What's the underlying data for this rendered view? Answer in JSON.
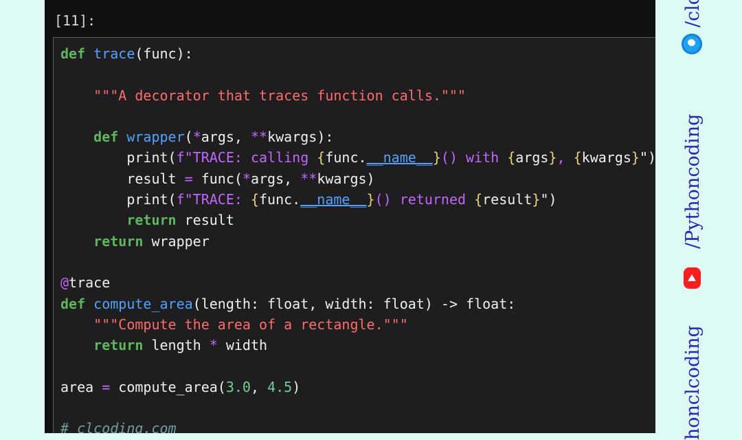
{
  "notebook": {
    "prompt": "[11]:",
    "code_lines": [
      [
        {
          "t": "def",
          "c": "kw"
        },
        {
          "t": " "
        },
        {
          "t": "trace",
          "c": "fn"
        },
        {
          "t": "(func):"
        }
      ],
      [
        {
          "t": ""
        }
      ],
      [
        {
          "t": "    "
        },
        {
          "t": "\"\"\"A decorator that traces function calls.\"\"\"",
          "c": "str"
        }
      ],
      [
        {
          "t": ""
        }
      ],
      [
        {
          "t": "    "
        },
        {
          "t": "def",
          "c": "kw"
        },
        {
          "t": " "
        },
        {
          "t": "wrapper",
          "c": "fn"
        },
        {
          "t": "("
        },
        {
          "t": "*",
          "c": "op"
        },
        {
          "t": "args, "
        },
        {
          "t": "**",
          "c": "op"
        },
        {
          "t": "kwargs):"
        }
      ],
      [
        {
          "t": "        print("
        },
        {
          "t": "f\"TRACE: calling ",
          "c": "fstr"
        },
        {
          "t": "{",
          "c": "brace"
        },
        {
          "t": "func."
        },
        {
          "t": "__name__",
          "c": "dunder"
        },
        {
          "t": "}",
          "c": "brace"
        },
        {
          "t": "() with ",
          "c": "fstr"
        },
        {
          "t": "{",
          "c": "brace"
        },
        {
          "t": "args"
        },
        {
          "t": "}",
          "c": "brace"
        },
        {
          "t": ", ",
          "c": "fstr"
        },
        {
          "t": "{",
          "c": "brace"
        },
        {
          "t": "kwargs"
        },
        {
          "t": "}",
          "c": "brace"
        },
        {
          "t": "\")"
        }
      ],
      [
        {
          "t": "        result "
        },
        {
          "t": "=",
          "c": "op"
        },
        {
          "t": " func("
        },
        {
          "t": "*",
          "c": "op"
        },
        {
          "t": "args, "
        },
        {
          "t": "**",
          "c": "op"
        },
        {
          "t": "kwargs)"
        }
      ],
      [
        {
          "t": "        print("
        },
        {
          "t": "f\"TRACE: ",
          "c": "fstr"
        },
        {
          "t": "{",
          "c": "brace"
        },
        {
          "t": "func."
        },
        {
          "t": "__name__",
          "c": "dunder"
        },
        {
          "t": "}",
          "c": "brace"
        },
        {
          "t": "() returned ",
          "c": "fstr"
        },
        {
          "t": "{",
          "c": "brace"
        },
        {
          "t": "result"
        },
        {
          "t": "}",
          "c": "brace"
        },
        {
          "t": "\")"
        }
      ],
      [
        {
          "t": "        "
        },
        {
          "t": "return",
          "c": "kw"
        },
        {
          "t": " result"
        }
      ],
      [
        {
          "t": "    "
        },
        {
          "t": "return",
          "c": "kw"
        },
        {
          "t": " wrapper"
        }
      ],
      [
        {
          "t": ""
        }
      ],
      [
        {
          "t": "@",
          "c": "op"
        },
        {
          "t": "trace"
        }
      ],
      [
        {
          "t": "def",
          "c": "kw"
        },
        {
          "t": " "
        },
        {
          "t": "compute_area",
          "c": "fn"
        },
        {
          "t": "(length: float, width: float) -> float:"
        }
      ],
      [
        {
          "t": "    "
        },
        {
          "t": "\"\"\"Compute the area of a rectangle.\"\"\"",
          "c": "str"
        }
      ],
      [
        {
          "t": "    "
        },
        {
          "t": "return",
          "c": "kw"
        },
        {
          "t": " length "
        },
        {
          "t": "*",
          "c": "op"
        },
        {
          "t": " width"
        }
      ],
      [
        {
          "t": ""
        }
      ],
      [
        {
          "t": "area "
        },
        {
          "t": "=",
          "c": "op"
        },
        {
          "t": " compute_area("
        },
        {
          "t": "3.0",
          "c": "num"
        },
        {
          "t": ", "
        },
        {
          "t": "4.5",
          "c": "num"
        },
        {
          "t": ")"
        }
      ],
      [
        {
          "t": ""
        }
      ],
      [
        {
          "t": "# clcoding.com",
          "c": "cmt"
        }
      ]
    ]
  },
  "sidebar": {
    "top_handle": "/clc",
    "youtube_handle": "/Pythoncoding",
    "bottom_handle": "honclcoding",
    "icons": [
      "twitter-icon",
      "youtube-icon"
    ],
    "text_color": "#2a24c8"
  }
}
